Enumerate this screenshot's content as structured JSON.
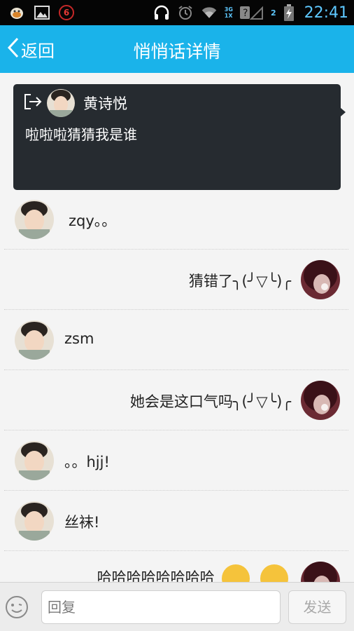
{
  "status_bar": {
    "notification_count": "6",
    "network_top": "3G",
    "network_bottom": "1X",
    "sim1": "1",
    "sim2": "2",
    "time": "22:41"
  },
  "header": {
    "back_label": "返回",
    "title": "悄悄话详情"
  },
  "original_post": {
    "author": "黄诗悦",
    "text": "啦啦啦猜猜我是谁"
  },
  "messages": [
    {
      "side": "left",
      "text": "zqy。。"
    },
    {
      "side": "right",
      "text": "猜错了╮(╯▽╰)╭"
    },
    {
      "side": "left",
      "text": "zsm"
    },
    {
      "side": "right",
      "text": "她会是这口气吗╮(╯▽╰)╭"
    },
    {
      "side": "left",
      "text": "。。hjj!"
    },
    {
      "side": "left",
      "text": "丝袜!"
    },
    {
      "side": "right",
      "text": "哈哈哈哈哈哈哈哈"
    }
  ],
  "input_bar": {
    "reply_placeholder": "回复",
    "send_label": "发送"
  },
  "colors": {
    "accent": "#1ab3ea",
    "status_bar_bg": "#050505",
    "origin_card_bg": "#262b30",
    "page_bg": "#f4f4f4"
  }
}
